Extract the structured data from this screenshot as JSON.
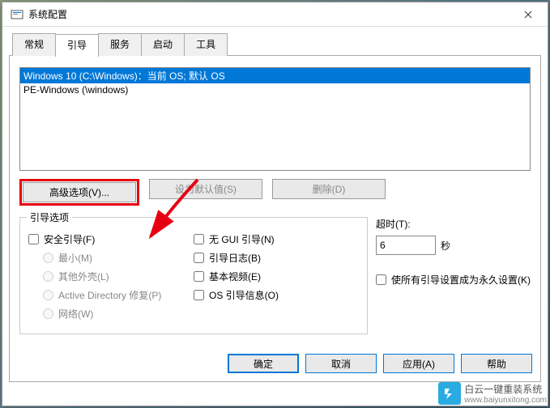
{
  "window": {
    "title": "系统配置"
  },
  "tabs": [
    "常规",
    "引导",
    "服务",
    "启动",
    "工具"
  ],
  "active_tab": 1,
  "boot_list": [
    {
      "text": "Windows 10 (C:\\Windows)：当前 OS; 默认 OS",
      "selected": true
    },
    {
      "text": "PE-Windows (\\windows)",
      "selected": false
    }
  ],
  "buttons": {
    "advanced": "高级选项(V)...",
    "set_default": "设为默认值(S)",
    "delete": "删除(D)"
  },
  "groupbox_title": "引导选项",
  "left_options": {
    "safe_boot": "安全引导(F)",
    "radios": [
      "最小(M)",
      "其他外壳(L)",
      "Active Directory 修复(P)",
      "网络(W)"
    ]
  },
  "mid_options": [
    "无 GUI 引导(N)",
    "引导日志(B)",
    "基本视频(E)",
    "OS 引导信息(O)"
  ],
  "right": {
    "timeout_label": "超时(T):",
    "timeout_value": "6",
    "timeout_unit": "秒",
    "permanent": "使所有引导设置成为永久设置(K)"
  },
  "footer": {
    "ok": "确定",
    "cancel": "取消",
    "apply": "应用(A)",
    "help": "帮助"
  },
  "watermark": {
    "brand": "白云一键重装系统",
    "url": "www.baiyunxitong.com"
  }
}
